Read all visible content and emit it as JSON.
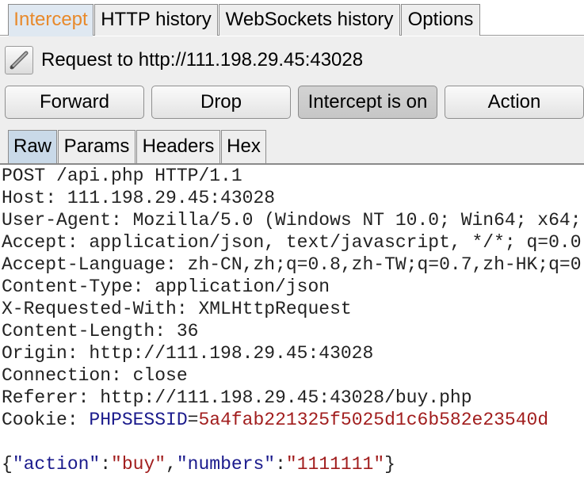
{
  "top_tabs": [
    "Intercept",
    "HTTP history",
    "WebSockets history",
    "Options"
  ],
  "request_bar": {
    "icon": "pencil-icon",
    "title": "Request to http://111.198.29.45:43028"
  },
  "buttons": {
    "forward": "Forward",
    "drop": "Drop",
    "intercept": "Intercept is on",
    "action": "Action"
  },
  "sub_tabs": [
    "Raw",
    "Params",
    "Headers",
    "Hex"
  ],
  "request": {
    "lines": [
      "POST /api.php HTTP/1.1",
      "Host: 111.198.29.45:43028",
      "User-Agent: Mozilla/5.0 (Windows NT 10.0; Win64; x64;",
      "Accept: application/json, text/javascript, */*; q=0.0",
      "Accept-Language: zh-CN,zh;q=0.8,zh-TW;q=0.7,zh-HK;q=0",
      "Content-Type: application/json",
      "X-Requested-With: XMLHttpRequest",
      "Content-Length: 36",
      "Origin: http://111.198.29.45:43028",
      "Connection: close",
      "Referer: http://111.198.29.45:43028/buy.php"
    ],
    "cookie_label": "Cookie: ",
    "cookie_name": "PHPSESSID",
    "cookie_eq": "=",
    "cookie_value": "5a4fab221325f5025d1c6b582e23540d",
    "body": {
      "open": "{",
      "k1": "\"action\"",
      "colon1": ":",
      "v1": "\"buy\"",
      "comma": ",",
      "k2": "\"numbers\"",
      "colon2": ":",
      "v2": "\"1111111\"",
      "close": "}"
    }
  },
  "colors": {
    "active_tab_text": "#e8892a",
    "json_key": "#1a1a8c",
    "json_value": "#a11d1d"
  }
}
